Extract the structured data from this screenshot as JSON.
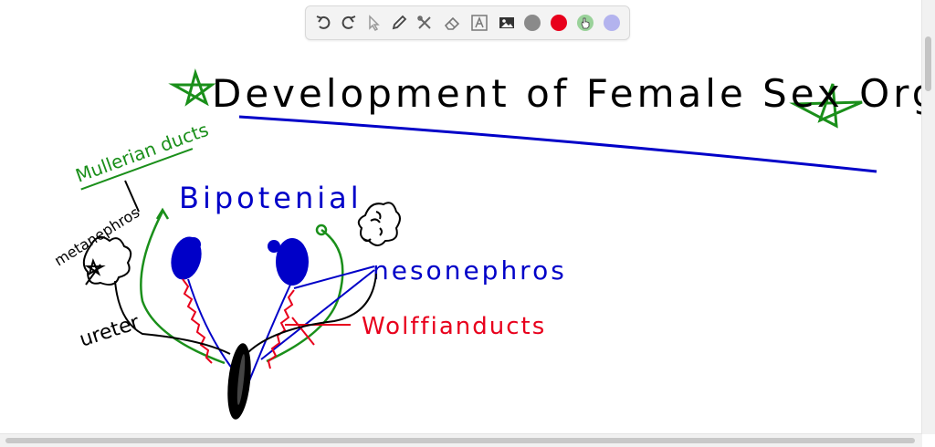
{
  "toolbar": {
    "tools": [
      {
        "name": "undo-icon",
        "label": "Undo"
      },
      {
        "name": "redo-icon",
        "label": "Redo"
      },
      {
        "name": "pointer-icon",
        "label": "Select"
      },
      {
        "name": "pen-icon",
        "label": "Pen"
      },
      {
        "name": "tools-icon",
        "label": "Tools"
      },
      {
        "name": "eraser-icon",
        "label": "Eraser"
      },
      {
        "name": "text-icon",
        "label": "Text"
      },
      {
        "name": "image-icon",
        "label": "Image"
      }
    ],
    "colors": {
      "gray": "#8a8a8a",
      "red": "#e8001c",
      "green": "#9ad29a",
      "purple": "#b3b3ee"
    }
  },
  "drawing": {
    "title": "Development of Female Sex Orgons",
    "labels": {
      "muellerian": "Mullerian ducts",
      "bipotential": "Bipotenial",
      "metanephros": "metanephros",
      "mesonephros": "nesonephros",
      "wolffian": "Wolffianducts",
      "ureter": "ureter"
    },
    "ink_colors": {
      "black": "#000000",
      "blue": "#0000c8",
      "green": "#1a8f1a",
      "red": "#e8001c"
    }
  }
}
